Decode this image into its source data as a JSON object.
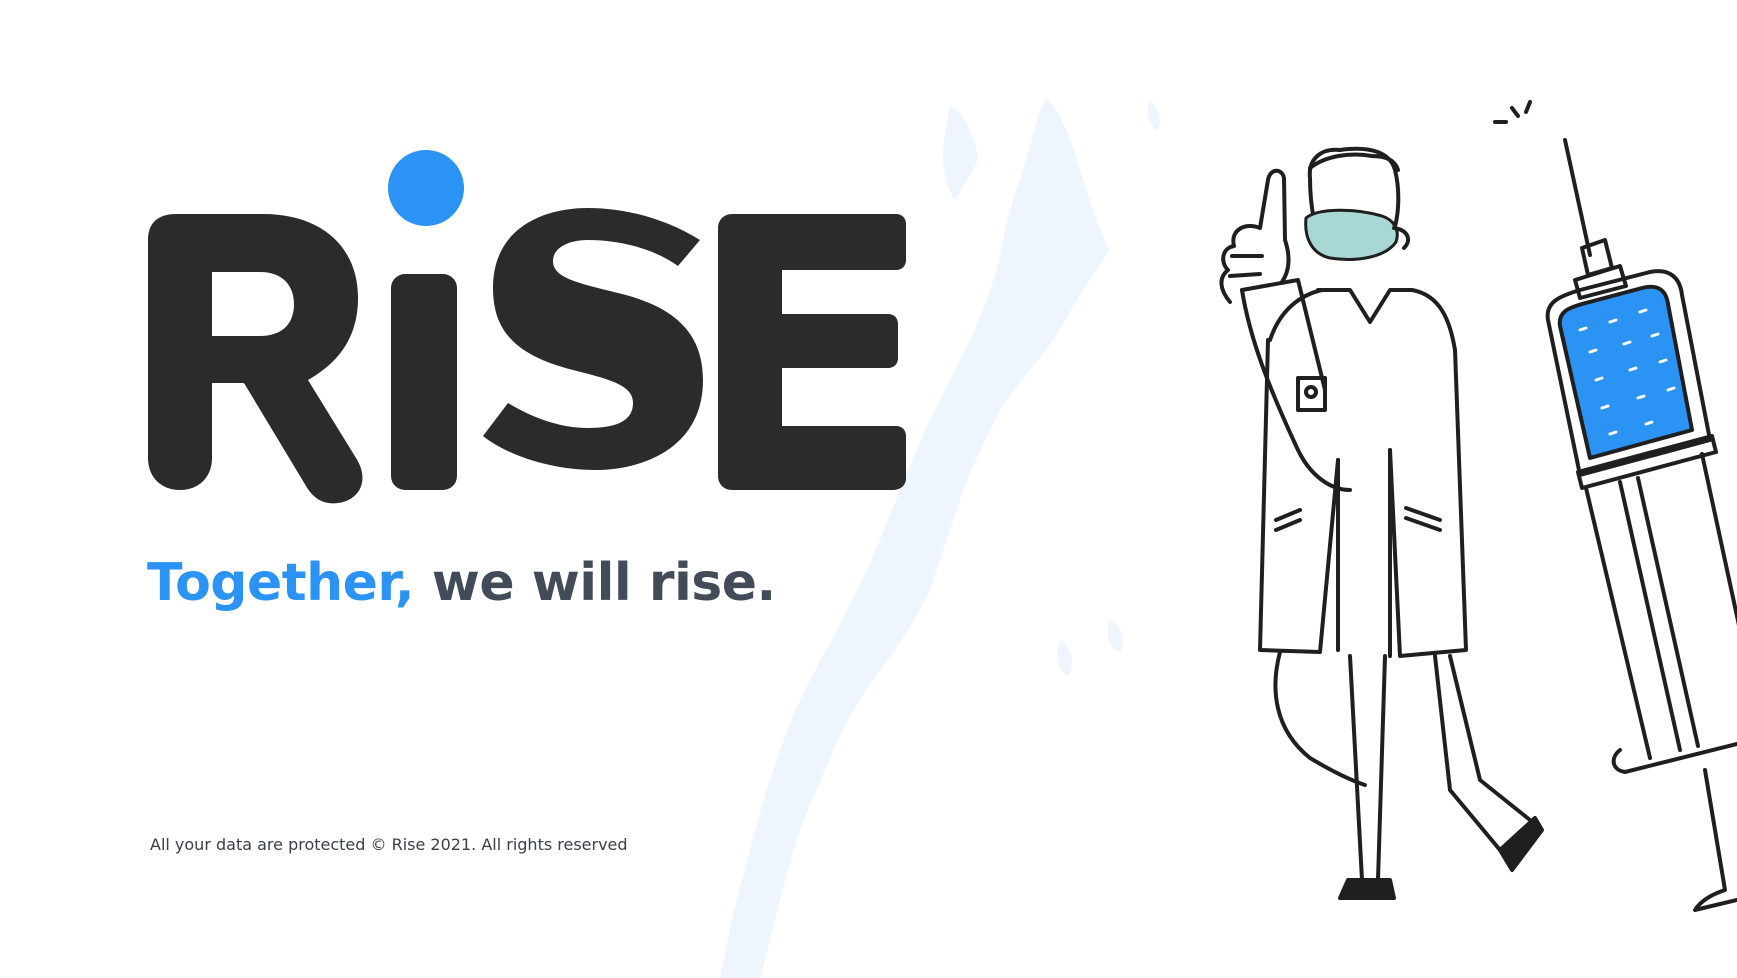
{
  "brand": {
    "logo_text": "RiSE",
    "logo_color": "#2b2b2b",
    "accent_color": "#2b93f3"
  },
  "tagline": {
    "accent": "Together,",
    "rest": "we will rise."
  },
  "footer": {
    "text": "All your data are protected © Rise 2021. All rights reserved"
  },
  "illustration": {
    "icon": "doctor-with-syringe-illustration",
    "background": "map-silhouette",
    "mask_color": "#a8d8d4",
    "vaccine_color": "#2b93f3"
  }
}
